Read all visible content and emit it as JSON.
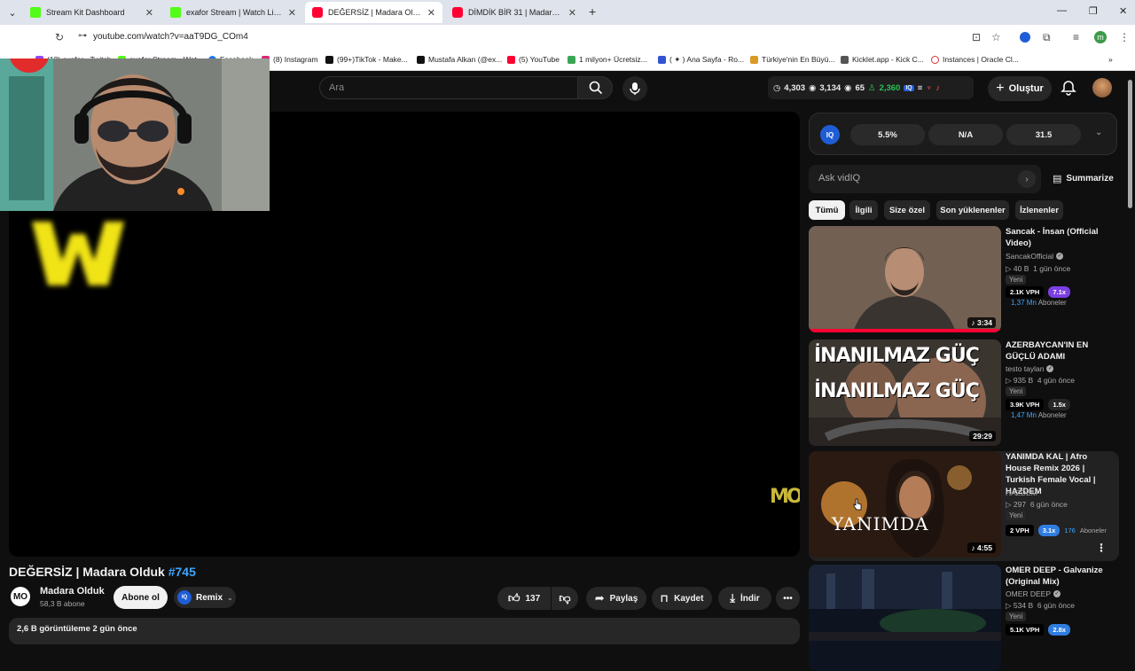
{
  "browser": {
    "tabs": [
      {
        "label": "Stream Kit Dashboard",
        "favicon_color": "#53fc18",
        "active": false
      },
      {
        "label": "exafor Stream | Watch Live on Kick",
        "favicon_color": "#53fc18",
        "active": false
      },
      {
        "label": "DEĞERSİZ | Madara Olduk #745",
        "favicon_color": "#ff0033",
        "active": true
      },
      {
        "label": "DİMDİK BİR 31 | Madara Olduk",
        "favicon_color": "#ff0033",
        "active": false
      }
    ],
    "new_tab": "+",
    "url": "youtube.com/watch?v=aaT9DG_COm4",
    "bookmarks": [
      "(12) exafor - Twitch",
      "exafor Stream - Wat...",
      "Facebook",
      "(8) Instagram",
      "(99+)TikTok - Make...",
      "Mustafa Alkan (@ex...",
      "(5) YouTube",
      "1 milyon+ Ücretsiz...",
      "( ✦ ) Ana Sayfa - Ro...",
      "Türkiye'nin En Büyü...",
      "Kicklet.app - Kick C...",
      "Instances | Oracle Cl..."
    ],
    "profile_initial": "m"
  },
  "masthead": {
    "search_placeholder": "Ara",
    "stats": {
      "clock": "4,303",
      "views": "3,134",
      "eye": "65",
      "people": "2,360"
    },
    "create_label": "Oluştur"
  },
  "player": {
    "watermark": "MO"
  },
  "video": {
    "title": "DEĞERSİZ | Madara Olduk",
    "hashtag": "#745",
    "channel_name": "Madara Olduk",
    "channel_initials": "MO",
    "subscribers": "58,3 B abone",
    "subscribe_label": "Abone ol",
    "remix_label": "Remix",
    "likes": "137",
    "share_label": "Paylaş",
    "save_label": "Kaydet",
    "download_label": "İndir",
    "desc_meta": "2,6 B görüntüleme  2 gün önce"
  },
  "vidiq": {
    "logo": "IQ",
    "metrics": [
      "5.5%",
      "N/A",
      "31.5"
    ],
    "ask_placeholder": "Ask vidIQ",
    "summarize_label": "Summarize"
  },
  "chips": [
    "Tümü",
    "İlgili",
    "Size özel",
    "Son yüklenenler",
    "İzlenenler"
  ],
  "recommendations": [
    {
      "title": "Sancak - İnsan (Official Video)",
      "channel": "SancakOfficial",
      "views": "40 B",
      "age": "1 gün önce",
      "new": "Yeni",
      "vph": "2.1K VPH",
      "mult": "7.1x",
      "mult_color": "#7b3fe4",
      "subs_num": "1,37 Mn",
      "subs_label": "Aboneler",
      "duration": "3:34"
    },
    {
      "title": "AZERBAYCAN'IN EN GÜÇLÜ ADAMI",
      "channel": "testo taylan",
      "views": "935 B",
      "age": "4 gün önce",
      "new": "Yeni",
      "vph": "3.9K VPH",
      "mult": "1.5x",
      "mult_color": "#272727",
      "subs_num": "1,47 Mn",
      "subs_label": "Aboneler",
      "duration": "29:29",
      "thumb_text_1": "İNANILMAZ GÜÇ",
      "thumb_text_2": "İNANILMAZ GÜÇ"
    },
    {
      "title": "YANIMDA KAL | Afro House Remix 2026 | Turkish Female Vocal | HAZDEM",
      "channel": "HAZDEM",
      "views": "297",
      "age": "6 gün önce",
      "new": "Yeni",
      "vph": "2 VPH",
      "mult": "3.1x",
      "mult_color": "#2f7de1",
      "subs_num": "176",
      "subs_label": "Aboneler",
      "duration": "4:55",
      "thumb_text": "YANIMDA"
    },
    {
      "title": "OMER DEEP - Galvanize (Original Mix)",
      "channel": "OMER DEEP",
      "views": "534 B",
      "age": "6 gün önce",
      "new": "Yeni",
      "vph": "5.1K VPH",
      "mult": "2.8x",
      "mult_color": "#2f7de1"
    }
  ]
}
